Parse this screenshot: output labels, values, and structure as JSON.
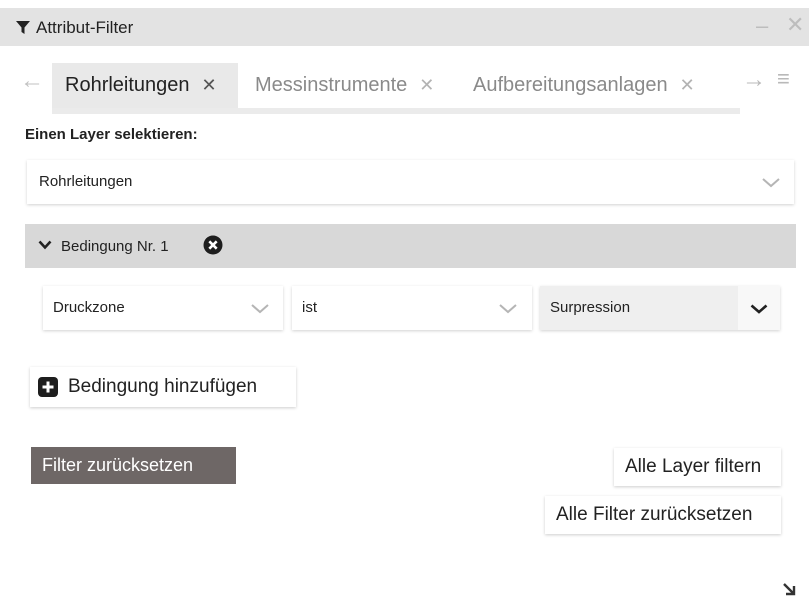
{
  "window": {
    "title": "Attribut-Filter",
    "title_icon": "filter-icon",
    "minimize_label": "–",
    "close_label": "✕"
  },
  "tabs": [
    {
      "label": "Rohrleitungen",
      "active": true
    },
    {
      "label": "Messinstrumente",
      "active": false
    },
    {
      "label": "Aufbereitungsanlagen",
      "active": false
    }
  ],
  "tab_close_label": "✕",
  "nav": {
    "prev_label": "←",
    "next_label": "→",
    "menu_label": "≡"
  },
  "layer": {
    "section_label": "Einen Layer selektieren:",
    "selected": "Rohrleitungen"
  },
  "condition": {
    "label": "Bedingung Nr. 1",
    "field": "Druckzone",
    "operator": "ist",
    "value": "Surpression"
  },
  "buttons": {
    "add_condition": "Bedingung hinzufügen",
    "reset_filter": "Filter zurücksetzen",
    "filter_all_layers": "Alle Layer filtern",
    "reset_all_filters": "Alle Filter zurücksetzen"
  },
  "colors": {
    "titlebar": "#e3e3e3",
    "condition_header": "#d8d8d8",
    "reset_button": "#6e6766"
  }
}
